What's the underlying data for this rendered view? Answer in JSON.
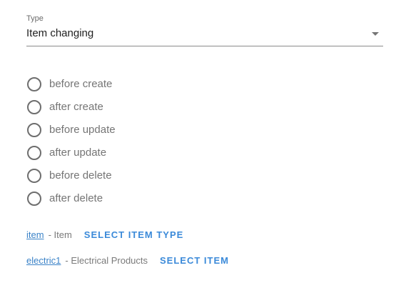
{
  "type_select": {
    "label": "Type",
    "value": "Item changing"
  },
  "radios": [
    {
      "label": "before create",
      "checked": false
    },
    {
      "label": "after create",
      "checked": false
    },
    {
      "label": "before update",
      "checked": false
    },
    {
      "label": "after update",
      "checked": false
    },
    {
      "label": "before delete",
      "checked": false
    },
    {
      "label": "after delete",
      "checked": false
    }
  ],
  "item_type_ref": {
    "link": "item",
    "description": "- Item",
    "button": "SELECT ITEM TYPE"
  },
  "item_ref": {
    "link": "electric1",
    "description": "- Electrical Products",
    "button": "SELECT ITEM"
  },
  "colors": {
    "accent": "#3b8ad9",
    "link": "#3b83c8",
    "text_primary": "#212121",
    "text_secondary": "#757575"
  },
  "icons": {
    "dropdown": "chevron-down-icon",
    "radio": "radio-unchecked-icon"
  }
}
